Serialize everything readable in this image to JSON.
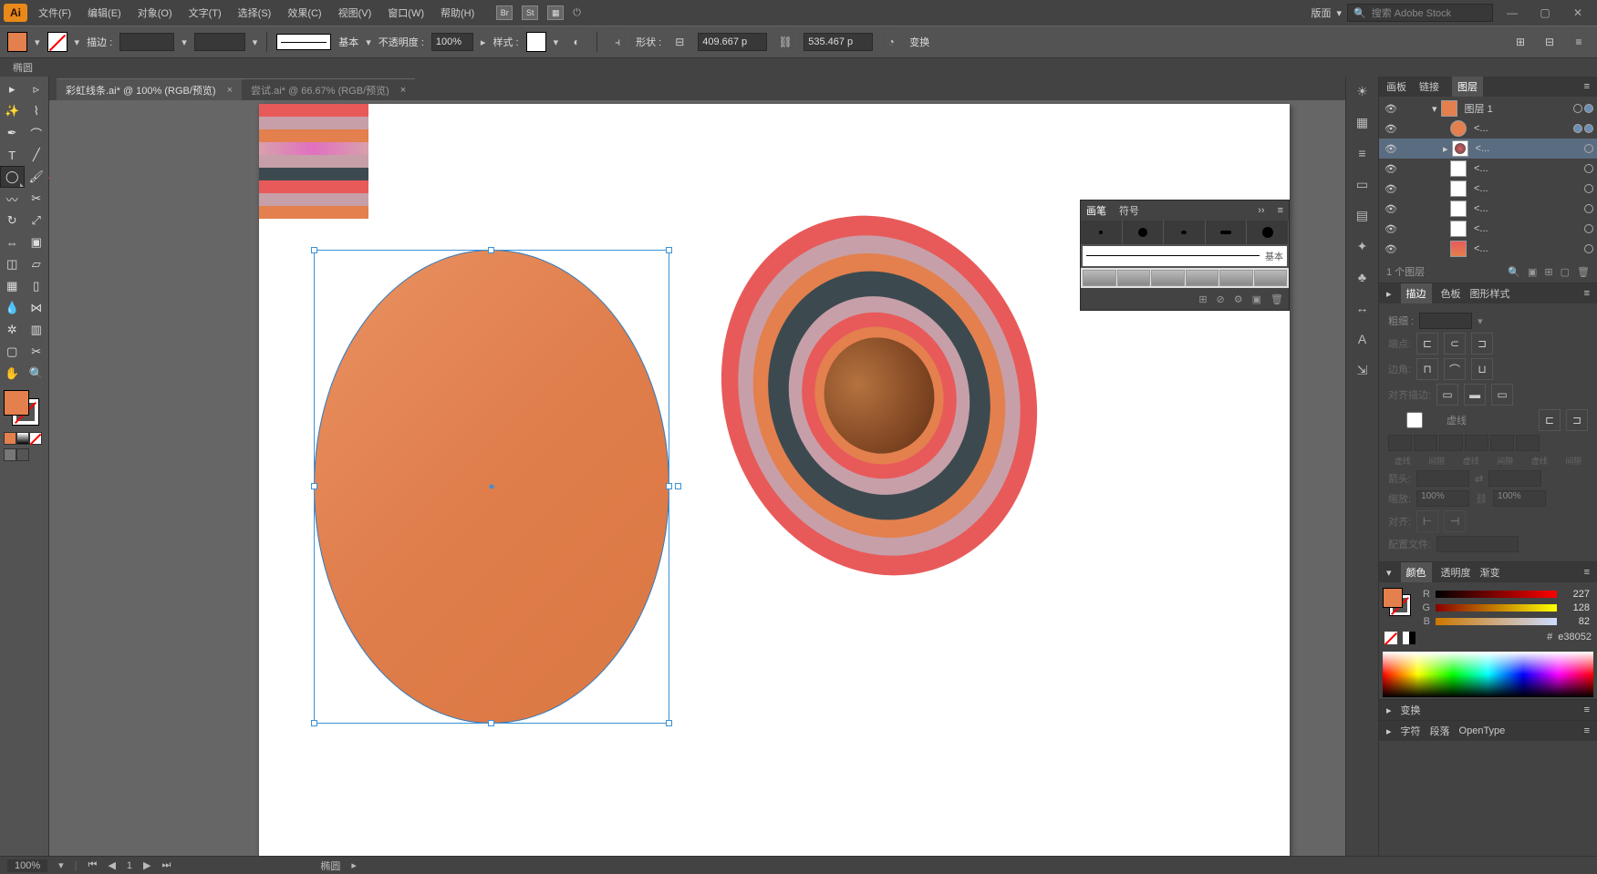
{
  "app": {
    "logo": "Ai"
  },
  "menu": [
    "文件(F)",
    "编辑(E)",
    "对象(O)",
    "文字(T)",
    "选择(S)",
    "效果(C)",
    "视图(V)",
    "窗口(W)",
    "帮助(H)"
  ],
  "top_icons": [
    "Br",
    "St"
  ],
  "top_right": {
    "preset_label": "版面",
    "search_placeholder": "搜索 Adobe Stock"
  },
  "control": {
    "stroke_label": "描边 :",
    "stroke_value": "",
    "profile_label": "基本",
    "opacity_label": "不透明度 :",
    "opacity_value": "100%",
    "style_label": "样式 :",
    "shape_label": "形状 :",
    "x_value": "409.667 p",
    "y_value": "535.467 p",
    "transform_label": "变换"
  },
  "tool_name": "椭圆",
  "tabs": [
    {
      "title": "彩虹线条.ai* @ 100% (RGB/预览)",
      "active": true
    },
    {
      "title": "尝试.ai* @ 66.67% (RGB/预览)",
      "active": false
    }
  ],
  "swatch_strip_colors": [
    "#E85A5A",
    "#C79FA8",
    "#E3804E",
    "#D89A5E",
    "#D9A0AC",
    "#3C4A50",
    "#E85A5A",
    "#C79FA8",
    "#E3804E"
  ],
  "brushes": {
    "tab1": "画笔",
    "tab2": "符号",
    "basic_label": "基本"
  },
  "dock_icons": [
    "☀",
    "▦",
    "≡",
    "▭",
    "▤",
    "✦",
    "♣",
    "↔",
    "A",
    "⇲"
  ],
  "panels": {
    "layers_tabs": [
      "画板",
      "链接",
      "图层"
    ],
    "layer_root": "图层 1",
    "sublayer_label": "<...",
    "layers_count": "1 个图层",
    "stroke_tabs": [
      "描边",
      "色板",
      "图形样式"
    ],
    "stroke_weight": "粗细 :",
    "dash_label": "虚线",
    "color_tabs": [
      "颜色",
      "透明度",
      "渐变"
    ],
    "r_label": "R",
    "r_val": "227",
    "g_label": "G",
    "g_val": "128",
    "b_label": "B",
    "b_val": "82",
    "hex": "e38052",
    "transform_tab": "变换",
    "char_tabs": [
      "字符",
      "段落",
      "OpenType"
    ]
  },
  "status": {
    "zoom": "100%",
    "nav": "1",
    "tool": "椭圆"
  }
}
